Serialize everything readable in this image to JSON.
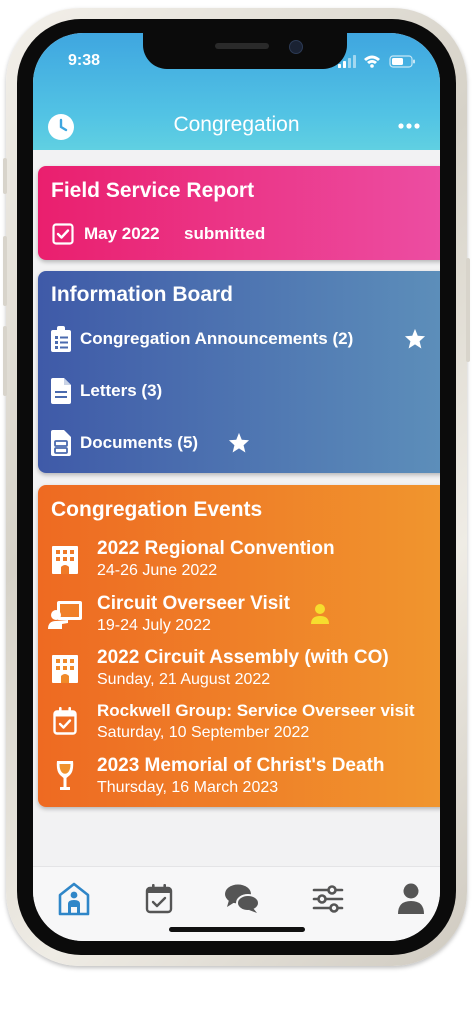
{
  "status_bar": {
    "time": "9:38"
  },
  "header": {
    "title": "Congregation",
    "left_icon": "clock-icon",
    "right_icon": "more-icon"
  },
  "field_service": {
    "title": "Field Service Report",
    "month": "May 2022",
    "status": "submitted",
    "color_start": "#ea1f6e",
    "color_end": "#ec4ea3"
  },
  "info_board": {
    "title": "Information Board",
    "items": [
      {
        "label": "Congregation Announcements (2)",
        "icon": "clipboard-list-icon",
        "starred": true
      },
      {
        "label": "Letters (3)",
        "icon": "document-icon",
        "starred": false
      },
      {
        "label": "Documents (5)",
        "icon": "documents-icon",
        "starred": true
      }
    ],
    "color_start": "#3f5aa8",
    "color_end": "#5d8fba"
  },
  "events": {
    "title": "Congregation Events",
    "items": [
      {
        "title": "2022 Regional Convention",
        "date": "24-26 June 2022",
        "icon": "building-icon"
      },
      {
        "title": "Circuit Overseer Visit",
        "date": "19-24 July 2022",
        "icon": "presenter-icon",
        "badge": "person-icon"
      },
      {
        "title": "2022 Circuit Assembly (with CO)",
        "date": "Sunday, 21 August 2022",
        "icon": "building-icon"
      },
      {
        "title": "Rockwell Group: Service Overseer visit",
        "date": "Saturday, 10 September 2022",
        "icon": "calendar-check-icon"
      },
      {
        "title": "2023 Memorial of Christ's Death",
        "date": "Thursday, 16 March 2023",
        "icon": "wine-glass-icon"
      }
    ],
    "color_start": "#ee6a22",
    "color_end": "#f0962e"
  },
  "tab_bar": {
    "tabs": [
      {
        "name": "congregation",
        "icon": "home-person-icon",
        "active": true
      },
      {
        "name": "calendar",
        "icon": "calendar-check-icon",
        "active": false
      },
      {
        "name": "messages",
        "icon": "chat-icon",
        "active": false
      },
      {
        "name": "settings",
        "icon": "sliders-icon",
        "active": false
      },
      {
        "name": "profile",
        "icon": "user-icon",
        "active": false
      }
    ],
    "active_color": "#2f86c8",
    "inactive_color": "#555555"
  }
}
